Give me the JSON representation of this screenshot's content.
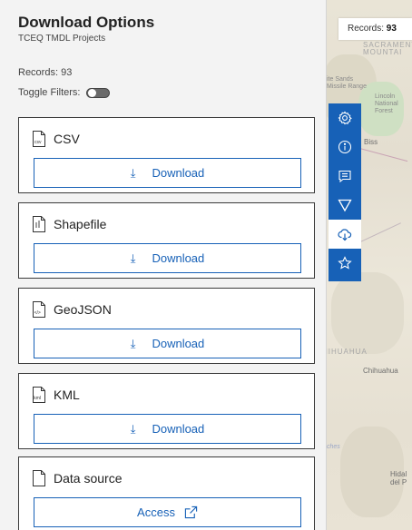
{
  "panel": {
    "title": "Download Options",
    "subtitle": "TCEQ TMDL Projects",
    "records_text": "Records: 93",
    "toggle_label": "Toggle Filters:"
  },
  "records_chip": {
    "label": "Records:",
    "value": "93"
  },
  "cards": [
    {
      "title": "CSV",
      "button": "Download",
      "icon": "csv-file-icon"
    },
    {
      "title": "Shapefile",
      "button": "Download",
      "icon": "shapefile-icon"
    },
    {
      "title": "GeoJSON",
      "button": "Download",
      "icon": "geojson-file-icon"
    },
    {
      "title": "KML",
      "button": "Download",
      "icon": "kml-file-icon"
    },
    {
      "title": "Data source",
      "button": "Access",
      "icon": "document-icon"
    }
  ],
  "map_labels": {
    "sacramento": "SACRAMENT MOUNTAI",
    "white_sands": "ite Sands Missile Range",
    "lincoln": "Lincoln National Forest",
    "biss": "Biss",
    "chihuahua_state": "HIHUAHUA",
    "chihuahua_city": "Chihuahua",
    "hidalgo": "Hidal del P",
    "ches": "ches"
  },
  "colors": {
    "accent": "#1761b7",
    "panel_bg": "#f3f3f3"
  }
}
